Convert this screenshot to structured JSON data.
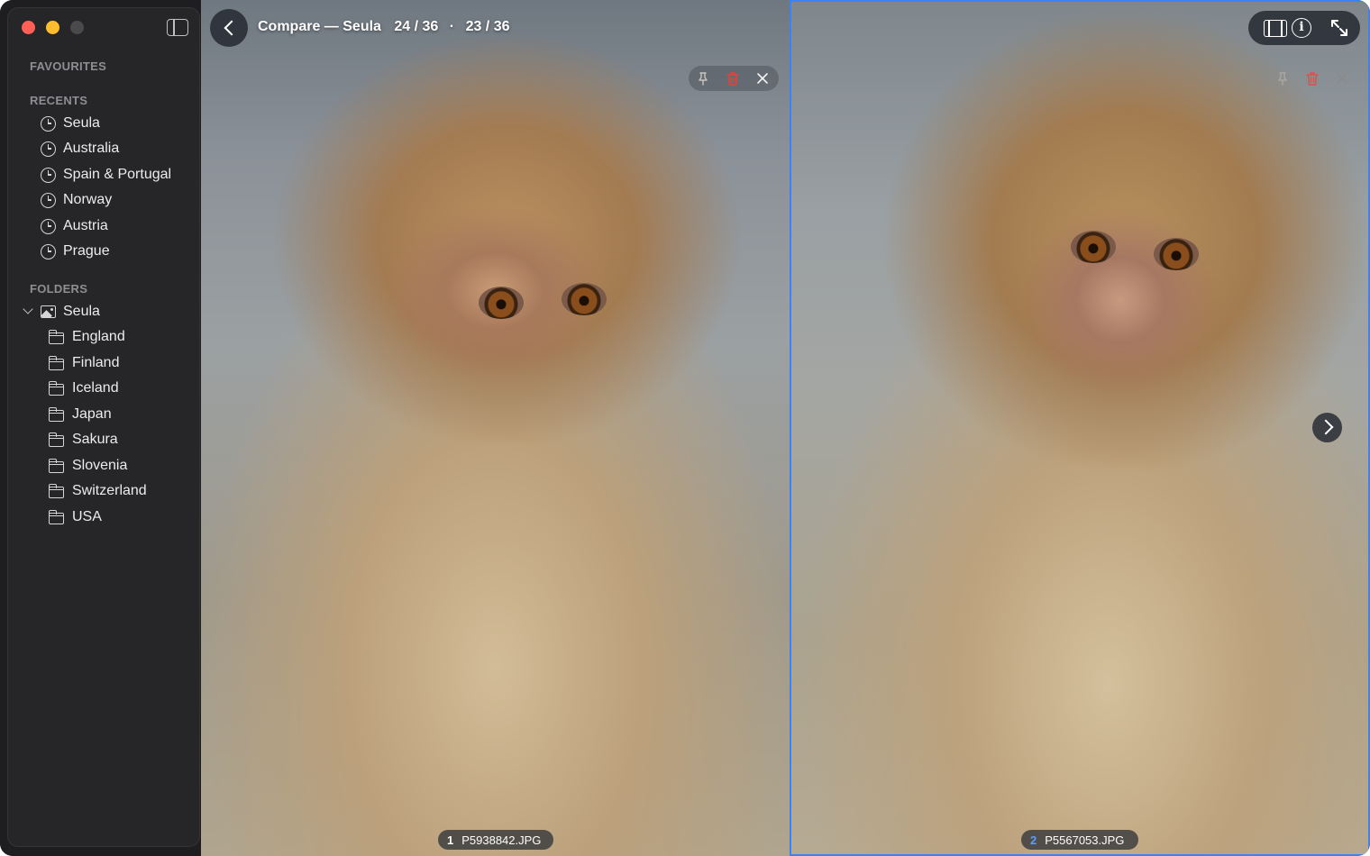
{
  "window": {
    "title": "Compare — Seula",
    "left_count": "24 / 36",
    "separator": "·",
    "right_count": "23 / 36"
  },
  "sidebar": {
    "favourites_header": "FAVOURITES",
    "recents_header": "RECENTS",
    "recents": [
      {
        "label": "Seula",
        "icon": "clock-icon"
      },
      {
        "label": "Australia",
        "icon": "clock-icon"
      },
      {
        "label": "Spain & Portugal",
        "icon": "clock-icon"
      },
      {
        "label": "Norway",
        "icon": "clock-icon"
      },
      {
        "label": "Austria",
        "icon": "clock-icon"
      },
      {
        "label": "Prague",
        "icon": "clock-icon"
      }
    ],
    "folders_header": "FOLDERS",
    "root_folder": {
      "label": "Seula",
      "icon": "photo-library-icon",
      "expanded": true
    },
    "subfolders": [
      {
        "label": "England",
        "icon": "folder-icon"
      },
      {
        "label": "Finland",
        "icon": "folder-icon"
      },
      {
        "label": "Iceland",
        "icon": "folder-icon"
      },
      {
        "label": "Japan",
        "icon": "folder-icon"
      },
      {
        "label": "Sakura",
        "icon": "folder-icon"
      },
      {
        "label": "Slovenia",
        "icon": "folder-icon"
      },
      {
        "label": "Switzerland",
        "icon": "folder-icon"
      },
      {
        "label": "USA",
        "icon": "folder-icon"
      }
    ]
  },
  "panes": {
    "left": {
      "index": "1",
      "filename": "P5938842.JPG",
      "selected": false
    },
    "right": {
      "index": "2",
      "filename": "P5567053.JPG",
      "selected": true
    }
  },
  "icons": {
    "toolbar": [
      "filmstrip-icon",
      "info-icon",
      "fullscreen-icon"
    ],
    "pane_actions": [
      "pin-icon",
      "trash-icon",
      "close-icon"
    ],
    "nav": [
      "back-icon",
      "next-icon"
    ]
  },
  "colors": {
    "selection_border": "#3b82f6",
    "trash": "#e0443c",
    "close_button": "#fe5f57",
    "minimize_button": "#febc2e",
    "sidebar_bg": "#262628"
  }
}
